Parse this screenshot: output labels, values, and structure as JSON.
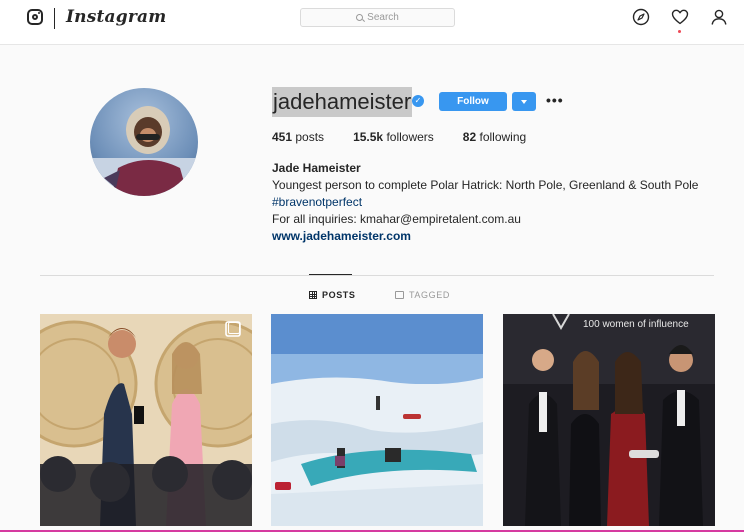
{
  "header": {
    "brand": "Instagram",
    "search": {
      "placeholder": "Search"
    },
    "icons": [
      "instagram-logo-icon",
      "explore-compass-icon",
      "activity-heart-icon",
      "profile-person-icon"
    ],
    "notification_dot_color": "#ed4956"
  },
  "profile": {
    "username": "jadehameister",
    "verified": true,
    "follow_label": "Follow",
    "more_label": "•••",
    "stats": {
      "posts_count": "451",
      "posts_label": "posts",
      "followers_count": "15.5k",
      "followers_label": "followers",
      "following_count": "82",
      "following_label": "following"
    },
    "bio": {
      "full_name": "Jade Hameister",
      "line1": "Youngest person to complete Polar Hatrick: North Pole, Greenland & South Pole",
      "hashtag": "#bravenotperfect",
      "line3": "For all inquiries: kmahar@empiretalent.com.au",
      "website": "www.jadehameister.com"
    }
  },
  "tabs": [
    {
      "label": "POSTS",
      "active": true,
      "icon": "grid-icon"
    },
    {
      "label": "TAGGED",
      "active": false,
      "icon": "tagged-icon"
    }
  ],
  "posts": [
    {
      "kind": "carousel",
      "icon": "carousel-icon"
    },
    {
      "kind": "photo"
    },
    {
      "kind": "photo",
      "banner": "100 women of influence"
    }
  ],
  "colors": {
    "accent": "#3897f0",
    "link": "#003569",
    "text": "#262626",
    "muted": "#999999"
  }
}
